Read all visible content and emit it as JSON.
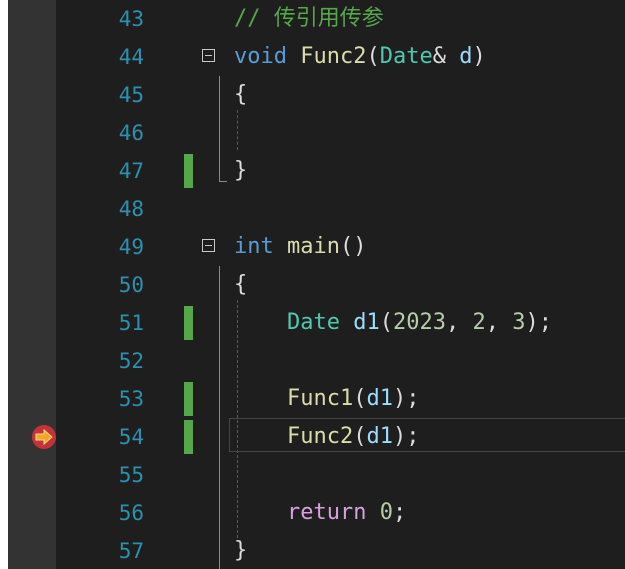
{
  "editor": {
    "lines": [
      {
        "number": "43",
        "modified": false,
        "fold": false,
        "tokens": [
          {
            "t": "// 传引用传参",
            "c": "comment"
          }
        ]
      },
      {
        "number": "44",
        "modified": false,
        "fold": true,
        "tokens": [
          {
            "t": "void",
            "c": "kw"
          },
          {
            "t": " ",
            "c": "punct"
          },
          {
            "t": "Func2",
            "c": "fn"
          },
          {
            "t": "(",
            "c": "punct"
          },
          {
            "t": "Date",
            "c": "type"
          },
          {
            "t": "& ",
            "c": "punct"
          },
          {
            "t": "d",
            "c": "param"
          },
          {
            "t": ")",
            "c": "punct"
          }
        ]
      },
      {
        "number": "45",
        "modified": false,
        "fold": false,
        "tokens": [
          {
            "t": "{",
            "c": "punct"
          }
        ]
      },
      {
        "number": "46",
        "modified": false,
        "fold": false,
        "tokens": []
      },
      {
        "number": "47",
        "modified": true,
        "fold": false,
        "tokens": [
          {
            "t": "}",
            "c": "punct"
          }
        ]
      },
      {
        "number": "48",
        "modified": false,
        "fold": false,
        "tokens": []
      },
      {
        "number": "49",
        "modified": false,
        "fold": true,
        "tokens": [
          {
            "t": "int",
            "c": "kw"
          },
          {
            "t": " ",
            "c": "punct"
          },
          {
            "t": "main",
            "c": "fn"
          },
          {
            "t": "()",
            "c": "punct"
          }
        ]
      },
      {
        "number": "50",
        "modified": false,
        "fold": false,
        "tokens": [
          {
            "t": "{",
            "c": "punct"
          }
        ]
      },
      {
        "number": "51",
        "modified": true,
        "fold": false,
        "tokens": [
          {
            "t": "    ",
            "c": "punct"
          },
          {
            "t": "Date",
            "c": "type"
          },
          {
            "t": " ",
            "c": "punct"
          },
          {
            "t": "d1",
            "c": "param"
          },
          {
            "t": "(",
            "c": "punct"
          },
          {
            "t": "2023",
            "c": "num"
          },
          {
            "t": ", ",
            "c": "punct"
          },
          {
            "t": "2",
            "c": "num"
          },
          {
            "t": ", ",
            "c": "punct"
          },
          {
            "t": "3",
            "c": "num"
          },
          {
            "t": ");",
            "c": "punct"
          }
        ]
      },
      {
        "number": "52",
        "modified": false,
        "fold": false,
        "tokens": []
      },
      {
        "number": "53",
        "modified": true,
        "fold": false,
        "tokens": [
          {
            "t": "    ",
            "c": "punct"
          },
          {
            "t": "Func1",
            "c": "fn"
          },
          {
            "t": "(",
            "c": "punct"
          },
          {
            "t": "d1",
            "c": "param"
          },
          {
            "t": ");",
            "c": "punct"
          }
        ]
      },
      {
        "number": "54",
        "modified": true,
        "fold": false,
        "tokens": [
          {
            "t": "    ",
            "c": "punct"
          },
          {
            "t": "Func2",
            "c": "fn"
          },
          {
            "t": "(",
            "c": "punct"
          },
          {
            "t": "d1",
            "c": "param"
          },
          {
            "t": ");",
            "c": "punct"
          }
        ]
      },
      {
        "number": "55",
        "modified": false,
        "fold": false,
        "tokens": []
      },
      {
        "number": "56",
        "modified": false,
        "fold": false,
        "tokens": [
          {
            "t": "    ",
            "c": "punct"
          },
          {
            "t": "return",
            "c": "kw2"
          },
          {
            "t": " ",
            "c": "punct"
          },
          {
            "t": "0",
            "c": "num"
          },
          {
            "t": ";",
            "c": "punct"
          }
        ]
      },
      {
        "number": "57",
        "modified": false,
        "fold": false,
        "tokens": [
          {
            "t": "}",
            "c": "punct"
          }
        ]
      }
    ],
    "current_line": "54",
    "execution_icon": "breakpoint-current-statement-icon",
    "colors": {
      "background": "#1e1e1e",
      "line_number": "#2b91af",
      "comment": "#57a64a",
      "keyword": "#569cd6",
      "control_keyword": "#d8a0df",
      "function": "#dcdcaa",
      "type": "#4ec9b0",
      "number": "#b5cea8",
      "parameter": "#9cdcfe",
      "change_marker": "#57a64a",
      "execution_arrow": "#f5a623"
    }
  }
}
